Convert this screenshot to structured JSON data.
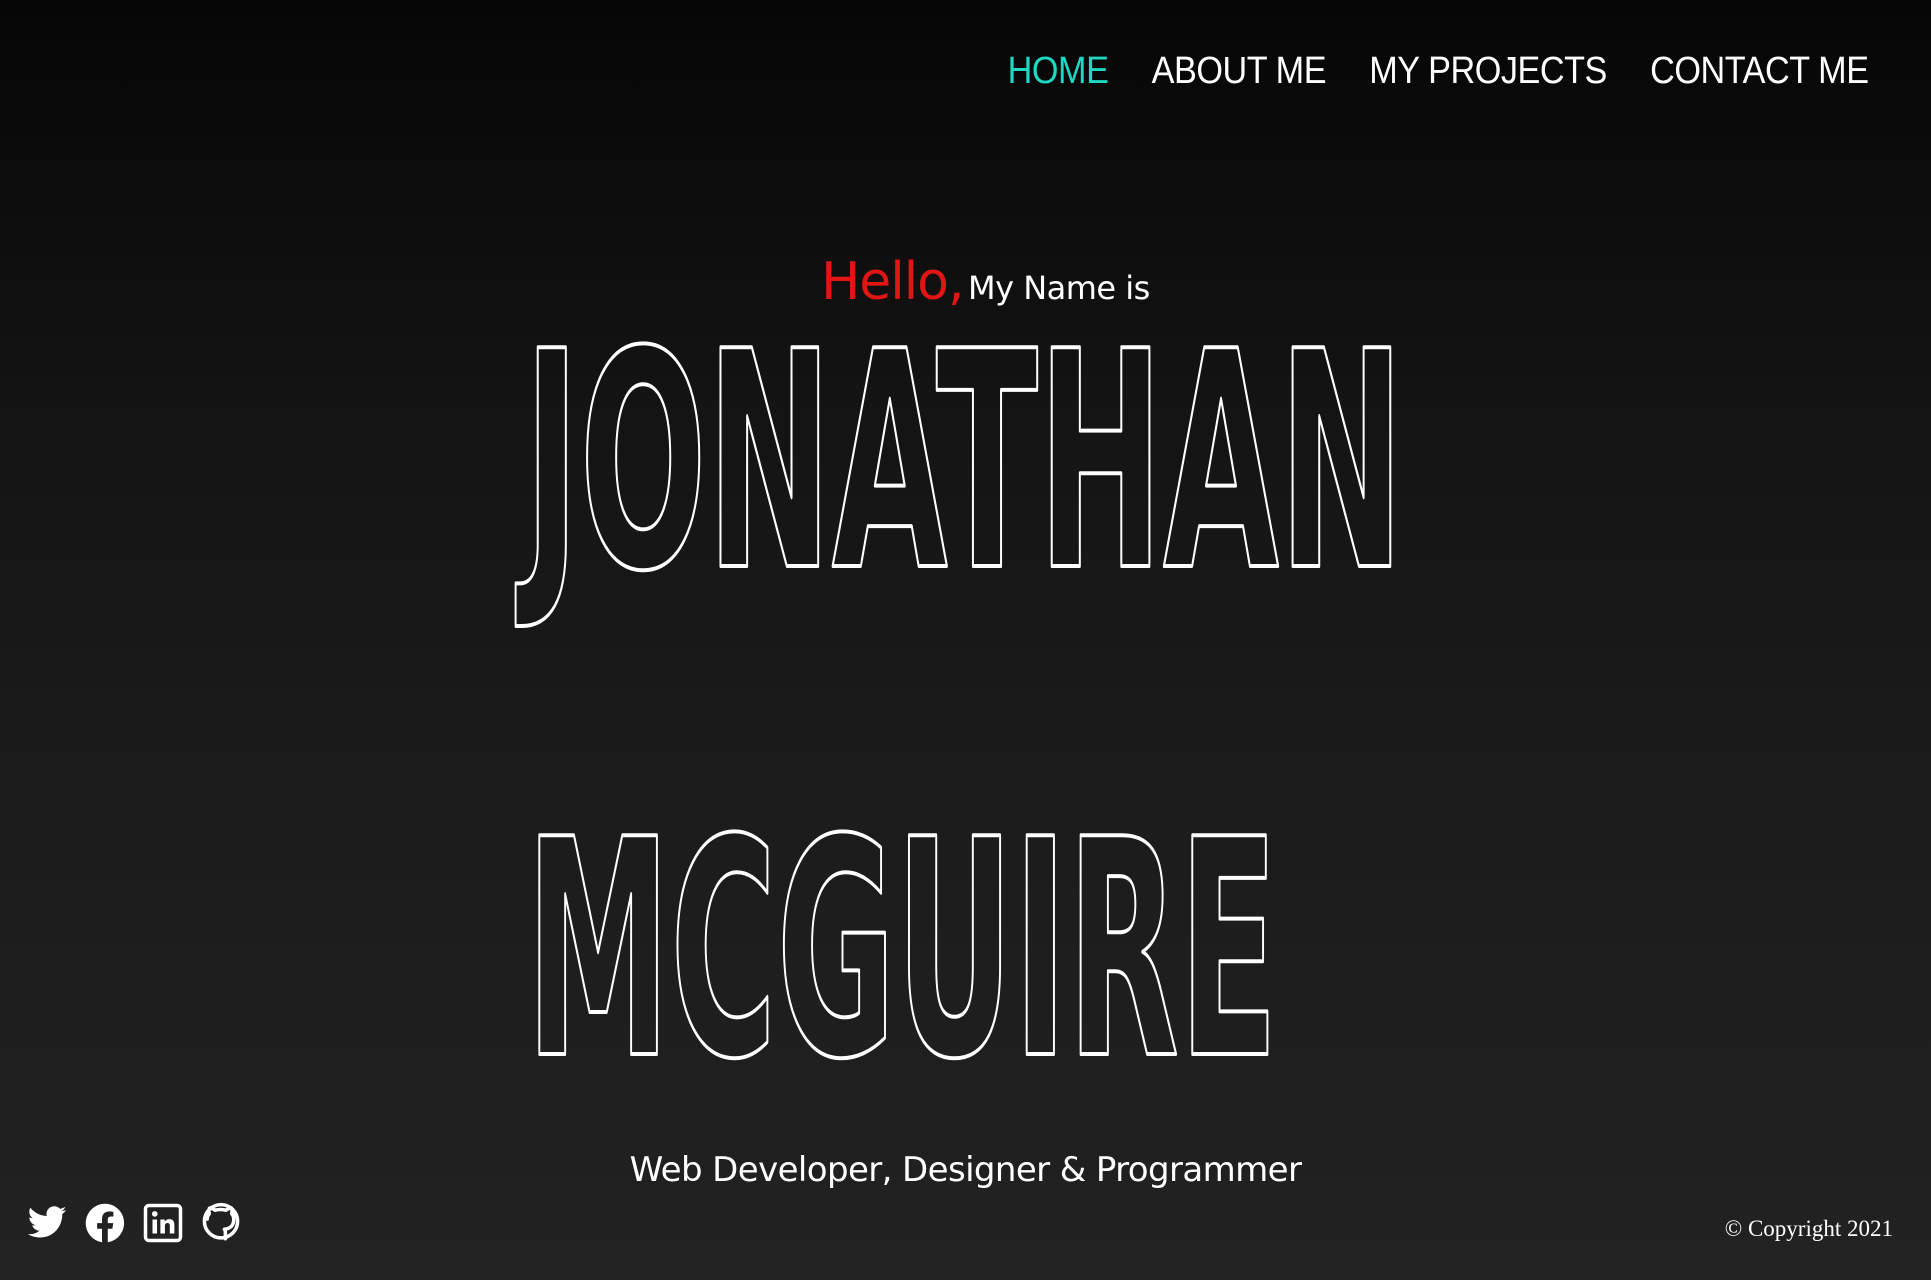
{
  "nav": {
    "items": [
      {
        "label": "HOME",
        "active": true
      },
      {
        "label": "ABOUT ME",
        "active": false
      },
      {
        "label": "MY PROJECTS",
        "active": false
      },
      {
        "label": "CONTACT ME",
        "active": false
      }
    ],
    "active_color": "#1fd8c4"
  },
  "hero": {
    "hello": "Hello,",
    "intro": "My Name is",
    "first_name": "JONATHAN",
    "last_name": "MCGUIRE",
    "tagline": "Web Developer, Designer & Programmer"
  },
  "social": [
    {
      "name": "twitter",
      "icon": "twitter-icon"
    },
    {
      "name": "facebook",
      "icon": "facebook-icon"
    },
    {
      "name": "linkedin",
      "icon": "linkedin-icon"
    },
    {
      "name": "github",
      "icon": "github-icon"
    }
  ],
  "footer": {
    "copyright": "© Copyright 2021"
  },
  "colors": {
    "hello": "#e21515",
    "text": "#ffffff",
    "background_top": "#060606",
    "background_bottom": "#222222"
  }
}
